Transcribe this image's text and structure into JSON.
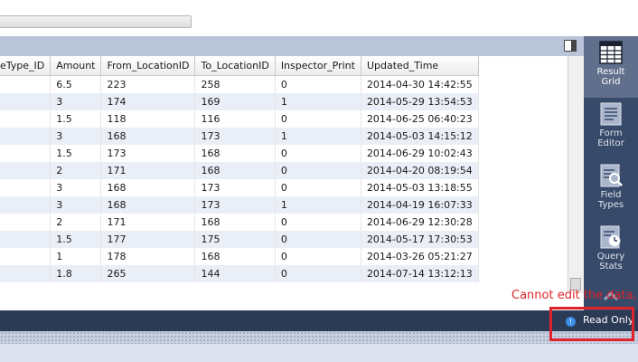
{
  "grid": {
    "columns": [
      "eType_ID",
      "Amount",
      "From_LocationID",
      "To_LocationID",
      "Inspector_Print",
      "Updated_Time"
    ],
    "rows": [
      [
        "",
        "6.5",
        "223",
        "258",
        "0",
        "2014-04-30 14:42:55"
      ],
      [
        "",
        "3",
        "174",
        "169",
        "1",
        "2014-05-29 13:54:53"
      ],
      [
        "",
        "1.5",
        "118",
        "116",
        "0",
        "2014-06-25 06:40:23"
      ],
      [
        "",
        "3",
        "168",
        "173",
        "1",
        "2014-05-03 14:15:12"
      ],
      [
        "",
        "1.5",
        "173",
        "168",
        "0",
        "2014-06-29 10:02:43"
      ],
      [
        "",
        "2",
        "171",
        "168",
        "0",
        "2014-04-20 08:19:54"
      ],
      [
        "",
        "3",
        "168",
        "173",
        "0",
        "2014-05-03 13:18:55"
      ],
      [
        "",
        "3",
        "168",
        "173",
        "1",
        "2014-04-19 16:07:33"
      ],
      [
        "",
        "2",
        "171",
        "168",
        "0",
        "2014-06-29 12:30:28"
      ],
      [
        "",
        "1.5",
        "177",
        "175",
        "0",
        "2014-05-17 17:30:53"
      ],
      [
        "",
        "1",
        "178",
        "168",
        "0",
        "2014-03-26 05:21:27"
      ],
      [
        "",
        "1.8",
        "265",
        "144",
        "0",
        "2014-07-14 13:12:13"
      ]
    ]
  },
  "sidebar": {
    "items": [
      {
        "label_line1": "Result",
        "label_line2": "Grid",
        "icon": "grid-icon"
      },
      {
        "label_line1": "Form",
        "label_line2": "Editor",
        "icon": "form-icon"
      },
      {
        "label_line1": "Field",
        "label_line2": "Types",
        "icon": "field-types-icon"
      },
      {
        "label_line1": "Query",
        "label_line2": "Stats",
        "icon": "query-stats-icon"
      }
    ]
  },
  "status": {
    "read_only": "Read Only",
    "icon": "info-icon"
  },
  "annotation": {
    "text": "Cannot edit the data,",
    "color": "#e0232b"
  },
  "colors": {
    "sidebar_bg": "#384a6a",
    "status_bg": "#2b3a55",
    "row_alt": "#e9eef7"
  }
}
